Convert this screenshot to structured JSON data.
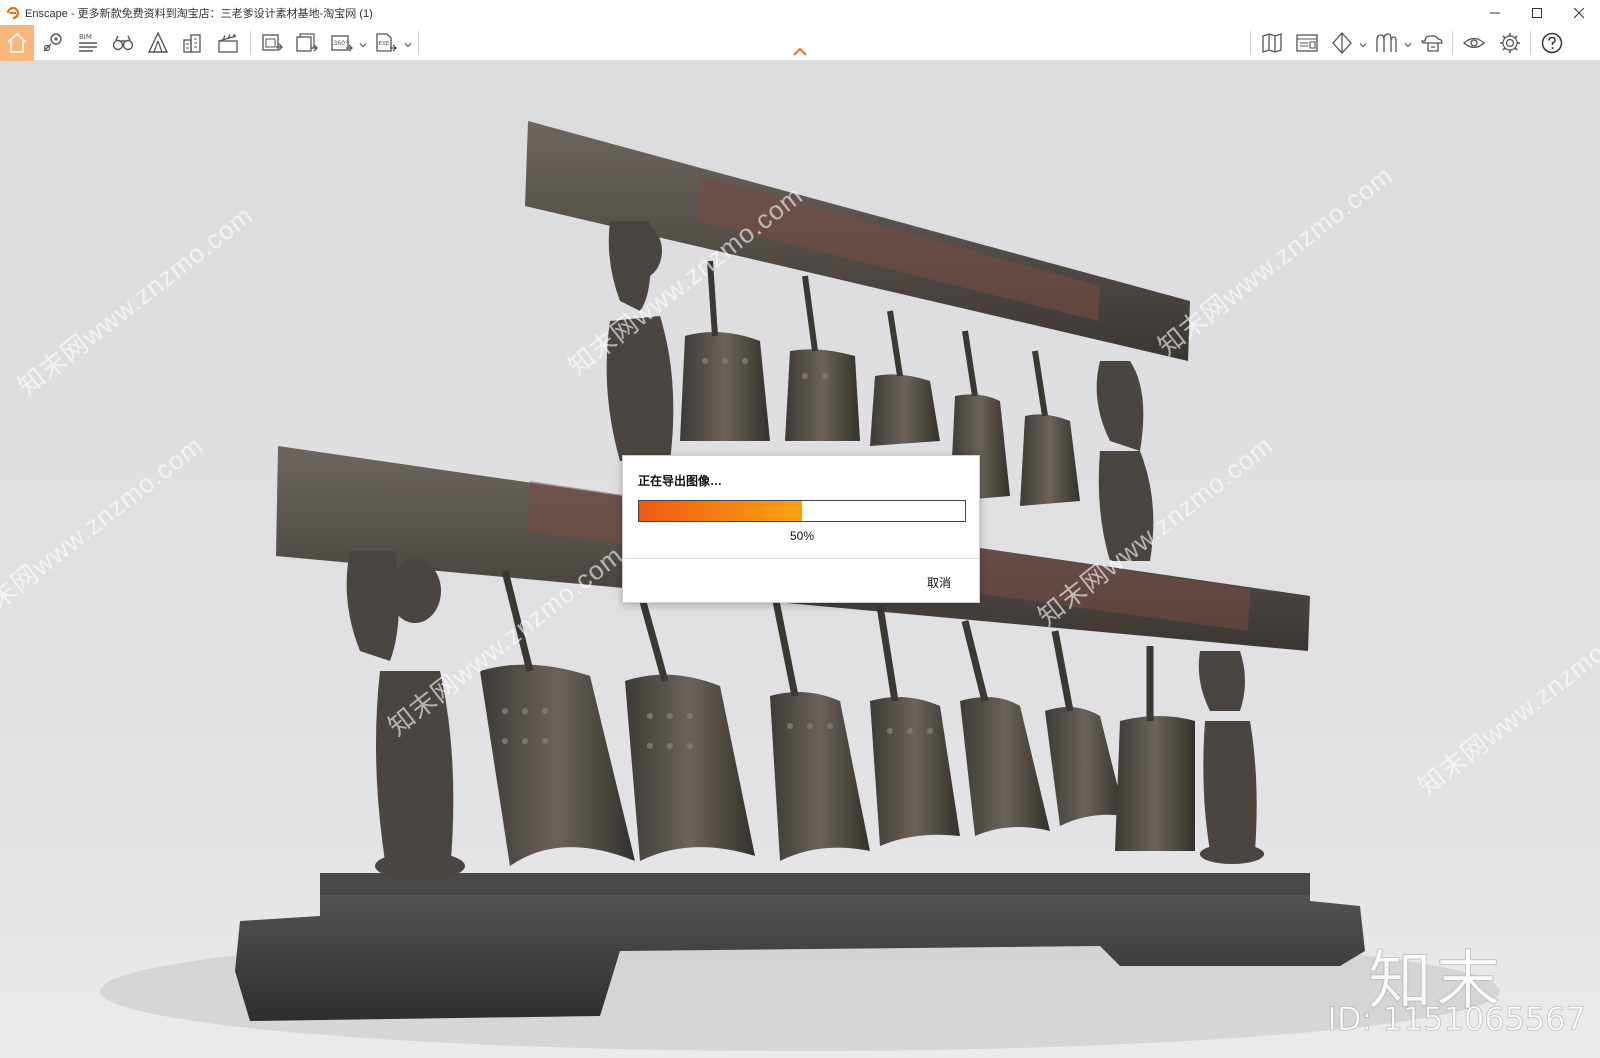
{
  "window": {
    "title": "Enscape - 更多新款免费资料到淘宝店：三老爹设计素材基地-淘宝网 (1)",
    "controls": [
      "minimize-icon",
      "maximize-icon",
      "close-icon"
    ]
  },
  "toolbar": {
    "left_icons": [
      "home-icon",
      "location-pin-icon",
      "bim-icon",
      "binoculars-icon",
      "tent-icon",
      "buildings-icon",
      "clapperboard-icon",
      "screenshot-export-icon",
      "batch-render-icon",
      "panorama-360-icon",
      "exe-export-icon"
    ],
    "bim_label": "BIM",
    "panorama_label": "360°",
    "exe_label": "EXE",
    "right_icons": [
      "map-icon",
      "material-editor-icon",
      "cube-view-icon",
      "asset-library-icon",
      "cloud-upload-icon",
      "eye-visual-settings-icon",
      "gear-settings-icon",
      "help-icon"
    ],
    "accent_color": "#f7b77a"
  },
  "dialog": {
    "title": "正在导出图像…",
    "progress": 0.5,
    "progress_text": "50%",
    "cancel_label": "取消",
    "progress_colors": [
      "#ee5a12",
      "#fca212"
    ]
  },
  "watermarks": {
    "site_text": "知末网www.znzmo.com",
    "brand": "知末",
    "id_text": "ID: 1151065567"
  }
}
